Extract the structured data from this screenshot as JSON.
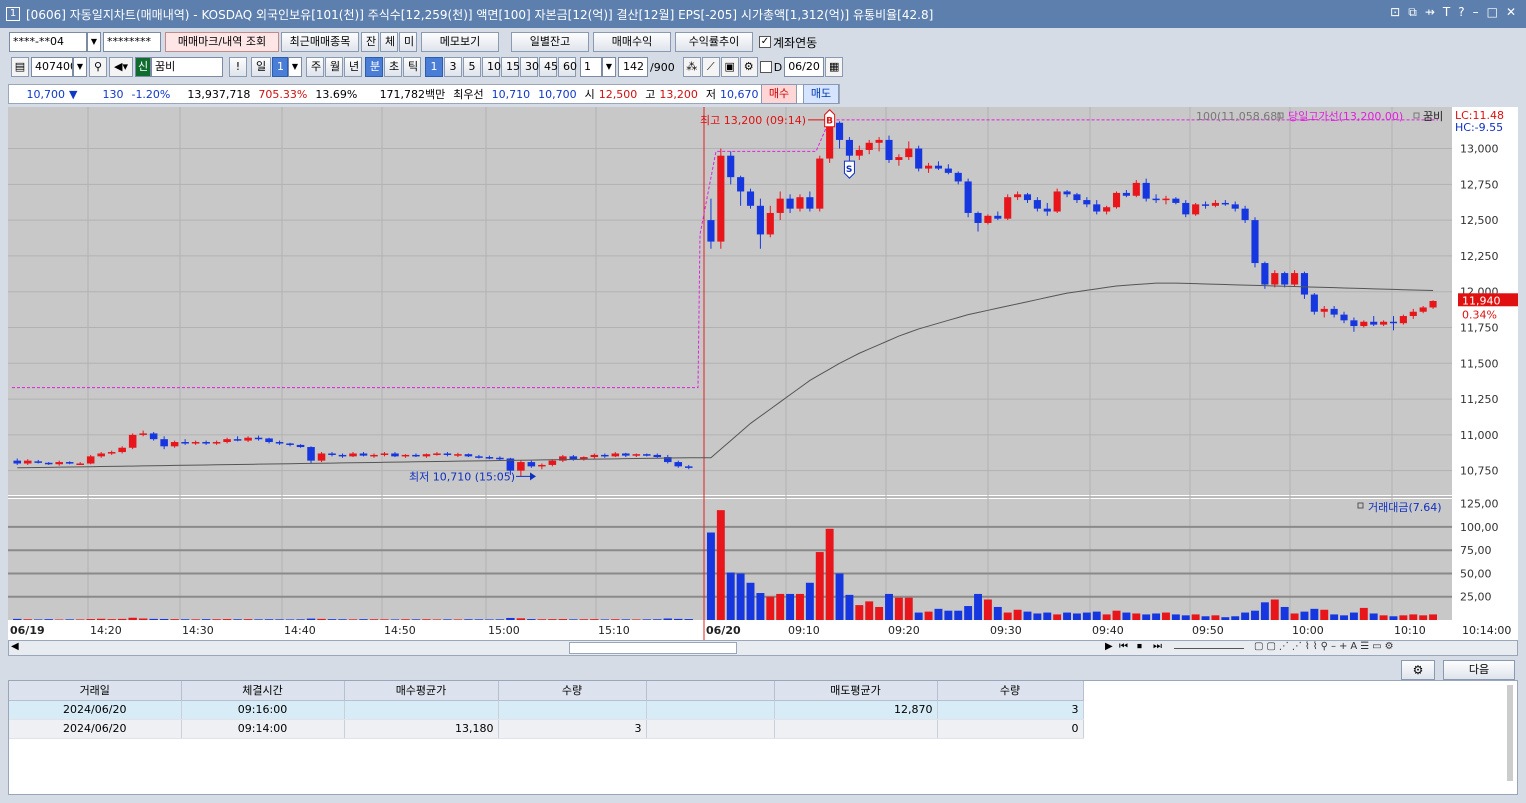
{
  "window": {
    "title": "[0606] 자동일지차트(매매내역) - KOSDAQ 외국인보유[101(천)] 주식수[12,259(천)] 액면[100] 자본금[12(억)] 결산[12월] EPS[-205] 시가총액[1,312(억)] 유통비율[42.8]",
    "number": "1",
    "controls": [
      "⊡",
      "⧉",
      "⇸",
      "T",
      "?",
      "–",
      "□",
      "✕"
    ]
  },
  "toolbar1": {
    "account": "****-**04",
    "password": "********",
    "btn_mark": "매매마크/내역 조회",
    "btn_recent": "최근매매종목",
    "btn_jan": "잔",
    "btn_che": "체",
    "btn_mi": "미",
    "btn_memo": "메모보기",
    "btn_daily": "일별잔고",
    "btn_profit": "매매수익",
    "btn_trend": "수익률추이",
    "link_label": "계좌연동",
    "link_checked": "✓"
  },
  "toolbar2": {
    "code": "407400",
    "badge": "신",
    "stock_name": "꿈비",
    "bang": "!",
    "day": "일",
    "day_num": "1",
    "ju": "주",
    "wol": "월",
    "nyeon": "년",
    "bun": "분",
    "cho": "초",
    "tick": "틱",
    "intervals": [
      "1",
      "3",
      "5",
      "10",
      "15",
      "30",
      "45",
      "60"
    ],
    "unit_value": "1",
    "count": "142",
    "count_max": "/900",
    "d_label": "D",
    "date": "06/20"
  },
  "quote": {
    "price": "10,700",
    "arrow": "▼",
    "change": "130",
    "pct": "-1.20%",
    "volume": "13,937,718",
    "vol_ratio": "705.33%",
    "turnover": "13.69%",
    "amount": "171,782백만",
    "best_label": "최우선",
    "best_ask": "10,710",
    "best_bid": "10,700",
    "open_label": "시",
    "open": "12,500",
    "high_label": "고",
    "high": "13,200",
    "low_label": "저",
    "low": "10,670",
    "buy_btn": "매수",
    "sell_btn": "매도"
  },
  "chart_data": {
    "type": "candlestick",
    "price_axis": {
      "ticks": [
        "13,000",
        "12,750",
        "12,500",
        "12,250",
        "12,000",
        "11,750",
        "11,500",
        "11,250",
        "11,000",
        "10,750"
      ],
      "range": [
        10580,
        13290
      ]
    },
    "volume_axis": {
      "ticks": [
        "125,00",
        "100,00",
        "75,00",
        "50,00",
        "25,00"
      ],
      "range": [
        0,
        130
      ]
    },
    "x_ticks": [
      "06/19",
      "14:20",
      "14:30",
      "14:40",
      "14:50",
      "15:00",
      "15:10",
      "06/20",
      "09:10",
      "09:20",
      "09:30",
      "09:40",
      "09:50",
      "10:00",
      "10:10",
      "10:14:00"
    ],
    "legend_ma": "100(11,058.68)",
    "legend_high_line": "당일고가선(13,200.00)",
    "legend_name": "꿈비",
    "lc": "LC:11.48",
    "hc": "HC:-9.55",
    "last_price": "11,940",
    "last_pct": "0.34%",
    "volume_legend": "거래대금(7.64)",
    "annot_high": "최고 13,200 (09:14)",
    "annot_low": "최저 10,710 (15:05)",
    "mark_buy": "B",
    "mark_sell": "S",
    "prev_high_line": 11330,
    "today_high_line": 13200,
    "up_color": "#e8151b",
    "down_color": "#1637e0",
    "ma_color": "#555555",
    "high_line_color": "#e020e0",
    "day1_candles": [
      [
        10820,
        10835,
        10790,
        10800
      ],
      [
        10800,
        10830,
        10790,
        10820
      ],
      [
        10815,
        10825,
        10800,
        10805
      ],
      [
        10805,
        10810,
        10790,
        10795
      ],
      [
        10795,
        10820,
        10785,
        10810
      ],
      [
        10810,
        10815,
        10795,
        10800
      ],
      [
        10800,
        10810,
        10790,
        10800
      ],
      [
        10800,
        10860,
        10795,
        10850
      ],
      [
        10850,
        10880,
        10840,
        10870
      ],
      [
        10870,
        10890,
        10860,
        10880
      ],
      [
        10880,
        10920,
        10870,
        10910
      ],
      [
        10910,
        11010,
        10900,
        11000
      ],
      [
        11000,
        11030,
        10990,
        11010
      ],
      [
        11010,
        11020,
        10960,
        10970
      ],
      [
        10970,
        10990,
        10900,
        10920
      ],
      [
        10920,
        10960,
        10910,
        10950
      ],
      [
        10950,
        10970,
        10930,
        10940
      ],
      [
        10940,
        10960,
        10930,
        10950
      ],
      [
        10950,
        10960,
        10930,
        10940
      ],
      [
        10940,
        10960,
        10930,
        10950
      ],
      [
        10950,
        10980,
        10940,
        10970
      ],
      [
        10970,
        10990,
        10955,
        10960
      ],
      [
        10960,
        10990,
        10950,
        10980
      ],
      [
        10980,
        10995,
        10960,
        10975
      ],
      [
        10975,
        10980,
        10940,
        10950
      ],
      [
        10950,
        10960,
        10930,
        10940
      ],
      [
        10940,
        10945,
        10920,
        10930
      ],
      [
        10930,
        10935,
        10910,
        10915
      ],
      [
        10915,
        10920,
        10800,
        10820
      ],
      [
        10820,
        10880,
        10810,
        10870
      ],
      [
        10870,
        10880,
        10850,
        10860
      ],
      [
        10860,
        10870,
        10840,
        10850
      ],
      [
        10850,
        10880,
        10845,
        10870
      ],
      [
        10870,
        10880,
        10850,
        10855
      ],
      [
        10855,
        10870,
        10840,
        10860
      ],
      [
        10860,
        10880,
        10850,
        10870
      ],
      [
        10870,
        10880,
        10845,
        10850
      ],
      [
        10850,
        10865,
        10840,
        10860
      ],
      [
        10860,
        10870,
        10845,
        10850
      ],
      [
        10850,
        10870,
        10840,
        10865
      ],
      [
        10865,
        10880,
        10855,
        10870
      ],
      [
        10870,
        10880,
        10850,
        10860
      ],
      [
        10860,
        10875,
        10845,
        10865
      ],
      [
        10865,
        10870,
        10845,
        10850
      ],
      [
        10850,
        10860,
        10835,
        10845
      ],
      [
        10845,
        10855,
        10830,
        10840
      ],
      [
        10840,
        10850,
        10825,
        10835
      ],
      [
        10835,
        10840,
        10720,
        10750
      ],
      [
        10750,
        10820,
        10710,
        10810
      ],
      [
        10810,
        10820,
        10770,
        10780
      ],
      [
        10780,
        10800,
        10760,
        10790
      ],
      [
        10790,
        10830,
        10780,
        10820
      ],
      [
        10820,
        10860,
        10810,
        10850
      ],
      [
        10850,
        10860,
        10820,
        10830
      ],
      [
        10830,
        10850,
        10820,
        10845
      ],
      [
        10845,
        10870,
        10835,
        10860
      ],
      [
        10860,
        10870,
        10840,
        10850
      ],
      [
        10850,
        10880,
        10845,
        10870
      ],
      [
        10870,
        10875,
        10845,
        10855
      ],
      [
        10855,
        10870,
        10845,
        10865
      ],
      [
        10865,
        10870,
        10850,
        10860
      ],
      [
        10860,
        10870,
        10840,
        10845
      ],
      [
        10845,
        10860,
        10800,
        10810
      ],
      [
        10810,
        10820,
        10770,
        10780
      ],
      [
        10780,
        10790,
        10760,
        10770
      ]
    ],
    "day2_candles": [
      [
        12500,
        12650,
        12300,
        12350
      ],
      [
        12350,
        13000,
        12300,
        12950
      ],
      [
        12950,
        12980,
        12750,
        12800
      ],
      [
        12800,
        12810,
        12600,
        12700
      ],
      [
        12700,
        12720,
        12580,
        12600
      ],
      [
        12600,
        12650,
        12300,
        12400
      ],
      [
        12400,
        12600,
        12380,
        12550
      ],
      [
        12550,
        12700,
        12500,
        12650
      ],
      [
        12650,
        12680,
        12550,
        12580
      ],
      [
        12580,
        12680,
        12560,
        12660
      ],
      [
        12660,
        12700,
        12560,
        12580
      ],
      [
        12580,
        12950,
        12560,
        12930
      ],
      [
        12930,
        13200,
        12900,
        13180
      ],
      [
        13180,
        13190,
        13000,
        13060
      ],
      [
        13060,
        13080,
        12900,
        12950
      ],
      [
        12950,
        13020,
        12920,
        12990
      ],
      [
        12990,
        13060,
        12960,
        13040
      ],
      [
        13040,
        13080,
        12980,
        13060
      ],
      [
        13060,
        13090,
        12900,
        12920
      ],
      [
        12920,
        12960,
        12880,
        12940
      ],
      [
        12940,
        13050,
        12920,
        13000
      ],
      [
        13000,
        13020,
        12840,
        12860
      ],
      [
        12860,
        12900,
        12830,
        12880
      ],
      [
        12880,
        12910,
        12850,
        12860
      ],
      [
        12860,
        12890,
        12820,
        12830
      ],
      [
        12830,
        12840,
        12750,
        12770
      ],
      [
        12770,
        12790,
        12520,
        12550
      ],
      [
        12550,
        12560,
        12420,
        12480
      ],
      [
        12480,
        12540,
        12470,
        12530
      ],
      [
        12530,
        12560,
        12500,
        12510
      ],
      [
        12510,
        12680,
        12500,
        12660
      ],
      [
        12660,
        12700,
        12640,
        12680
      ],
      [
        12680,
        12690,
        12620,
        12640
      ],
      [
        12640,
        12660,
        12560,
        12580
      ],
      [
        12580,
        12620,
        12530,
        12560
      ],
      [
        12560,
        12720,
        12550,
        12700
      ],
      [
        12700,
        12710,
        12660,
        12680
      ],
      [
        12680,
        12690,
        12620,
        12640
      ],
      [
        12640,
        12660,
        12590,
        12610
      ],
      [
        12610,
        12640,
        12540,
        12560
      ],
      [
        12560,
        12600,
        12540,
        12590
      ],
      [
        12590,
        12700,
        12580,
        12690
      ],
      [
        12690,
        12710,
        12660,
        12670
      ],
      [
        12670,
        12780,
        12660,
        12760
      ],
      [
        12760,
        12790,
        12630,
        12650
      ],
      [
        12650,
        12680,
        12620,
        12640
      ],
      [
        12640,
        12670,
        12610,
        12650
      ],
      [
        12650,
        12660,
        12610,
        12620
      ],
      [
        12620,
        12640,
        12520,
        12540
      ],
      [
        12540,
        12620,
        12530,
        12610
      ],
      [
        12610,
        12630,
        12580,
        12600
      ],
      [
        12600,
        12640,
        12590,
        12620
      ],
      [
        12620,
        12640,
        12600,
        12610
      ],
      [
        12610,
        12630,
        12560,
        12580
      ],
      [
        12580,
        12600,
        12480,
        12500
      ],
      [
        12500,
        12520,
        12170,
        12200
      ],
      [
        12200,
        12210,
        12020,
        12050
      ],
      [
        12050,
        12150,
        12030,
        12130
      ],
      [
        12130,
        12140,
        12030,
        12050
      ],
      [
        12050,
        12150,
        12040,
        12130
      ],
      [
        12130,
        12140,
        11950,
        11980
      ],
      [
        11980,
        11990,
        11840,
        11860
      ],
      [
        11860,
        11900,
        11820,
        11880
      ],
      [
        11880,
        11900,
        11820,
        11840
      ],
      [
        11840,
        11860,
        11780,
        11800
      ],
      [
        11800,
        11820,
        11720,
        11760
      ],
      [
        11760,
        11800,
        11750,
        11790
      ],
      [
        11790,
        11830,
        11760,
        11770
      ],
      [
        11770,
        11800,
        11760,
        11790
      ],
      [
        11790,
        11830,
        11730,
        11780
      ],
      [
        11780,
        11840,
        11770,
        11830
      ],
      [
        11830,
        11880,
        11810,
        11860
      ],
      [
        11860,
        11900,
        11850,
        11890
      ],
      [
        11890,
        11940,
        11880,
        11935
      ]
    ],
    "day1_volumes": [
      1.2,
      0.8,
      0.6,
      0.9,
      0.5,
      0.7,
      0.6,
      1.0,
      1.3,
      0.9,
      1.2,
      2.4,
      1.6,
      1.2,
      1.1,
      0.9,
      0.8,
      0.7,
      0.9,
      0.8,
      1.0,
      0.8,
      0.9,
      0.7,
      0.8,
      0.7,
      0.6,
      0.7,
      1.5,
      1.2,
      0.9,
      0.8,
      0.7,
      0.9,
      0.8,
      0.7,
      0.6,
      0.8,
      0.7,
      0.8,
      0.6,
      0.7,
      0.6,
      0.8,
      0.7,
      0.6,
      0.7,
      2.2,
      1.8,
      1.0,
      0.8,
      0.9,
      1.0,
      0.7,
      0.8,
      0.9,
      0.6,
      0.8,
      0.7,
      0.6,
      0.7,
      0.8,
      1.6,
      1.2,
      1.0
    ],
    "day2_volumes": [
      94,
      118,
      51,
      50,
      40,
      29,
      25,
      28,
      28,
      28,
      40,
      73,
      98,
      50,
      27,
      16,
      20,
      14,
      28,
      24,
      24,
      8,
      9,
      12,
      10,
      10,
      15,
      28,
      22,
      14,
      8,
      11,
      9,
      7,
      8,
      6,
      8,
      7,
      8,
      9,
      6,
      10,
      8,
      7,
      6,
      7,
      8,
      6,
      5,
      6,
      4,
      5,
      3,
      4,
      8,
      10,
      19,
      22,
      14,
      7,
      9,
      12,
      11,
      6,
      5,
      8,
      13,
      7,
      5,
      4,
      5,
      6,
      5,
      6
    ]
  },
  "scroll": {
    "left": "◀",
    "right": "▶",
    "nav": [
      "⏮",
      "⏹",
      "⏭"
    ]
  },
  "bottom": {
    "next_btn": "다음"
  },
  "trade_table": {
    "headers": [
      "거래일",
      "체결시간",
      "매수평균가",
      "수량",
      "",
      "매도평균가",
      "수량"
    ],
    "rows": [
      [
        "2024/06/20",
        "09:16:00",
        "",
        "",
        "",
        "12,870",
        "3"
      ],
      [
        "2024/06/20",
        "09:14:00",
        "13,180",
        "3",
        "",
        "",
        "0"
      ]
    ]
  }
}
